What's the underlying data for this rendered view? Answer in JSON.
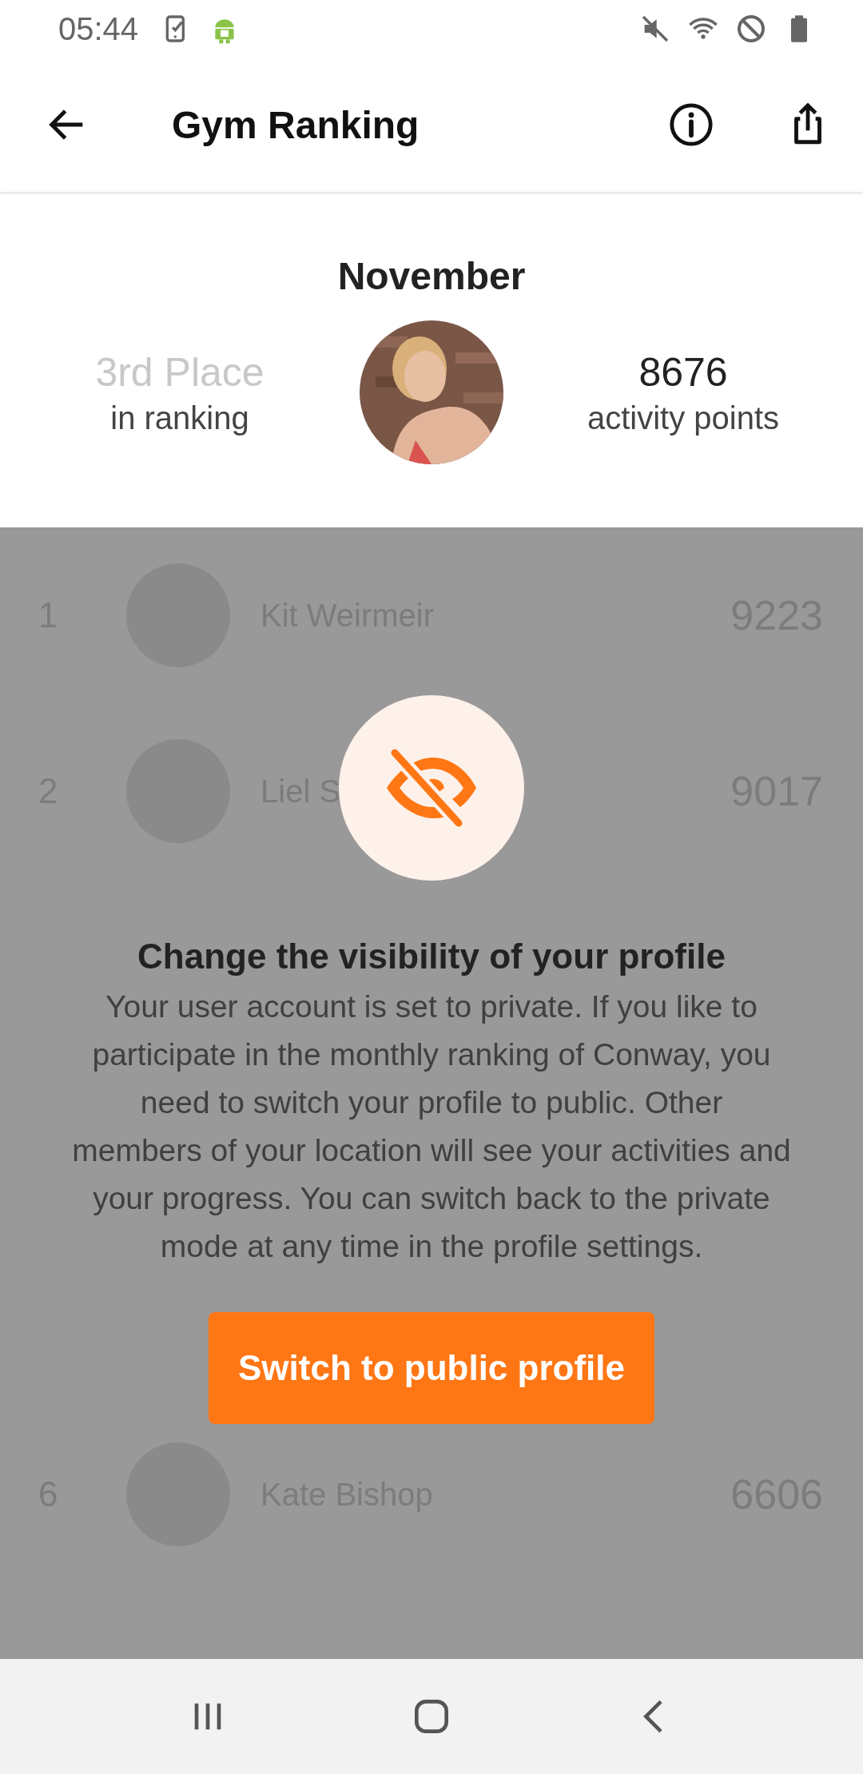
{
  "status_bar": {
    "time": "05:44"
  },
  "app_bar": {
    "title": "Gym Ranking"
  },
  "summary": {
    "month": "November",
    "place": "3rd Place",
    "place_caption": "in ranking",
    "points": "8676",
    "points_caption": "activity points"
  },
  "ranking_top": [
    {
      "rank": "1",
      "name": "Kit Weirmeir",
      "points": "9223"
    },
    {
      "rank": "2",
      "name": "Liel S",
      "points": "9017"
    }
  ],
  "ranking_bottom": [
    {
      "rank": "6",
      "name": "Kate Bishop",
      "points": "6606"
    }
  ],
  "dialog": {
    "title": "Change the visibility of your profile",
    "message": "Your user account is set to private. If you like to participate in the monthly ranking of Conway, you need to switch your profile to public. Other members of your location will see your activities and your progress. You can switch back to the private mode at any time in the profile settings.",
    "button": "Switch to public profile"
  }
}
